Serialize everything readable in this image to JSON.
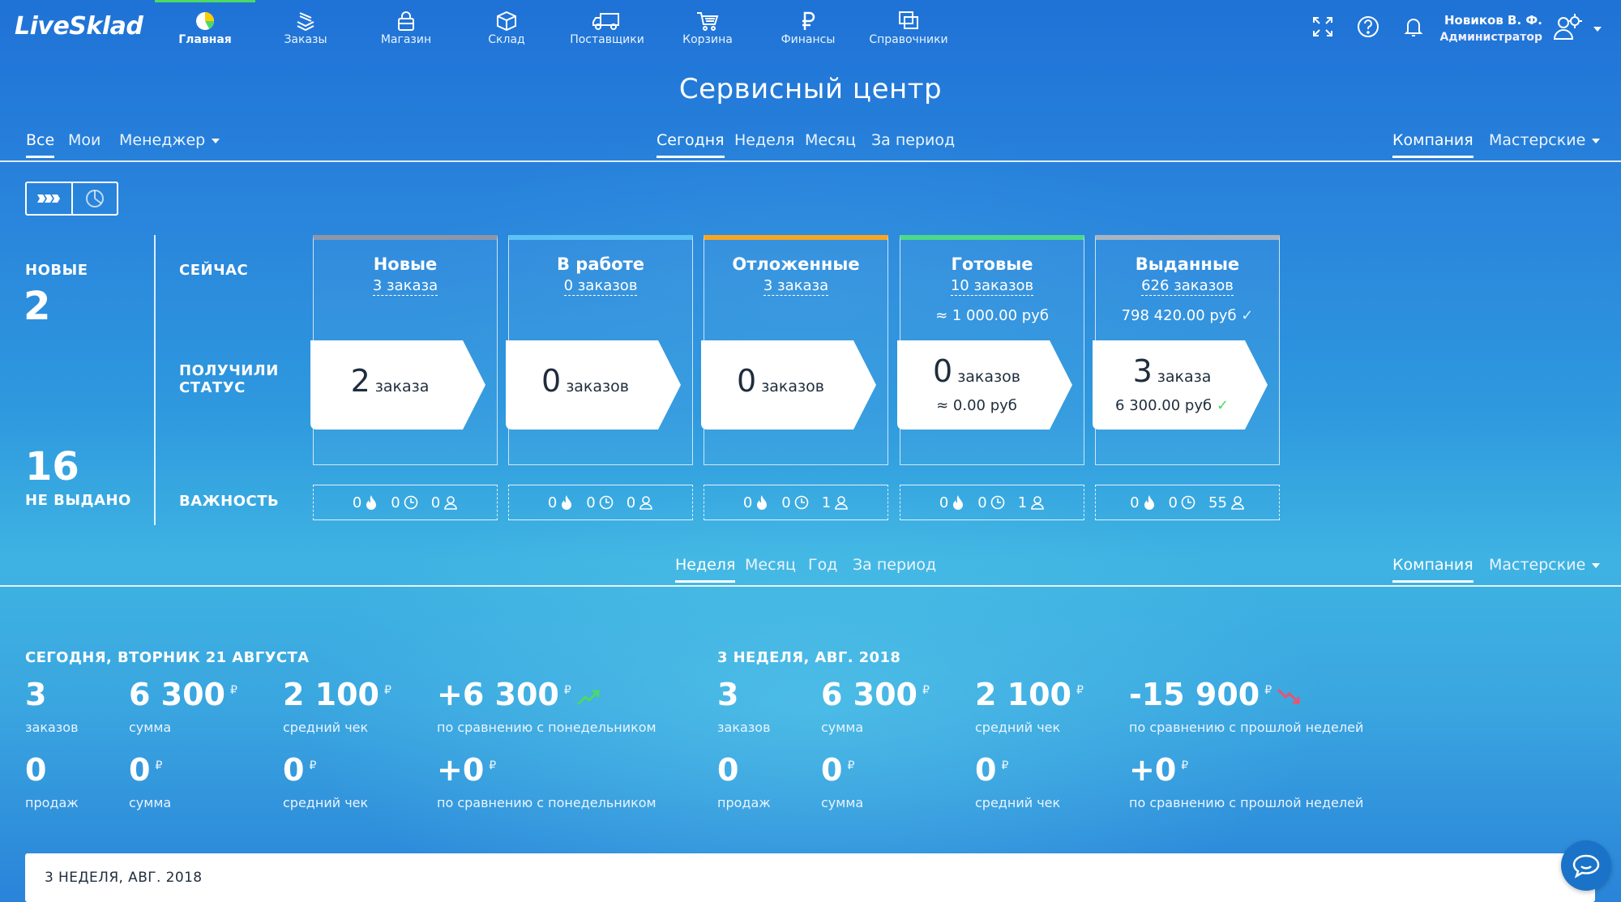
{
  "app": {
    "logo": "LiveSklad"
  },
  "nav": [
    {
      "label": "Главная",
      "icon": "pie-chart-icon",
      "active": true
    },
    {
      "label": "Заказы",
      "icon": "stack-icon"
    },
    {
      "label": "Магазин",
      "icon": "shopping-bag-icon"
    },
    {
      "label": "Склад",
      "icon": "box-icon"
    },
    {
      "label": "Поставщики",
      "icon": "truck-icon"
    },
    {
      "label": "Корзина",
      "icon": "cart-icon"
    },
    {
      "label": "Финансы",
      "icon": "ruble-icon"
    },
    {
      "label": "Справочники",
      "icon": "copy-icon"
    }
  ],
  "user": {
    "name": "Новиков В. Ф.",
    "role": "Администратор"
  },
  "page_title": "Сервисный центр",
  "filters_top": {
    "owner": [
      "Все",
      "Мои",
      "Менеджер"
    ],
    "period": [
      "Сегодня",
      "Неделя",
      "Месяц",
      "За период"
    ],
    "scope": [
      "Компания",
      "Мастерские"
    ]
  },
  "summary": {
    "new_label": "НОВЫЕ",
    "new_value": "2",
    "not_issued_value": "16",
    "not_issued_label": "НЕ ВЫДАНО",
    "now_label": "СЕЙЧАС",
    "got_status_label_1": "ПОЛУЧИЛИ",
    "got_status_label_2": "СТАТУС",
    "importance_label": "ВАЖНОСТЬ"
  },
  "statuses": [
    {
      "title": "Новые",
      "count": "3 заказа",
      "sum": "",
      "got_num": "2",
      "got_word": "заказа",
      "got_sum": "",
      "got_check": false,
      "color": "#8a97ab",
      "imp": [
        "0",
        "0",
        "0"
      ]
    },
    {
      "title": "В работе",
      "count": "0 заказов",
      "sum": "",
      "got_num": "0",
      "got_word": "заказов",
      "got_sum": "",
      "got_check": false,
      "color": "#5bc3f5",
      "imp": [
        "0",
        "0",
        "0"
      ]
    },
    {
      "title": "Отложенные",
      "count": "3 заказа",
      "sum": "",
      "got_num": "0",
      "got_word": "заказов",
      "got_sum": "",
      "got_check": false,
      "color": "#f5a623",
      "imp": [
        "0",
        "0",
        "1"
      ]
    },
    {
      "title": "Готовые",
      "count": "10 заказов",
      "sum": "≈ 1 000.00 руб",
      "got_num": "0",
      "got_word": "заказов",
      "got_sum": "≈ 0.00 руб",
      "got_check": false,
      "color": "#4cd98a",
      "imp": [
        "0",
        "0",
        "1"
      ]
    },
    {
      "title": "Выданные",
      "count": "626 заказов",
      "sum": "798 420.00 руб",
      "sum_check": "✓",
      "got_num": "3",
      "got_word": "заказа",
      "got_sum": "6 300.00 руб",
      "got_check": true,
      "color": "#a9b4c2",
      "imp": [
        "0",
        "0",
        "55"
      ]
    }
  ],
  "filters_mid": {
    "period": [
      "Неделя",
      "Месяц",
      "Год",
      "За период"
    ],
    "scope": [
      "Компания",
      "Мастерские"
    ]
  },
  "stats_today": {
    "header": "СЕГОДНЯ, ВТОРНИК 21 АВГУСТА",
    "row1": [
      {
        "value": "3",
        "cur": "",
        "label": "заказов"
      },
      {
        "value": "6 300",
        "cur": "₽",
        "label": "сумма"
      },
      {
        "value": "2 100",
        "cur": "₽",
        "label": "средний чек"
      },
      {
        "value": "+6 300",
        "cur": "₽",
        "label": "по сравнению с понедельником",
        "trend": "up"
      }
    ],
    "row2": [
      {
        "value": "0",
        "cur": "",
        "label": "продаж"
      },
      {
        "value": "0",
        "cur": "₽",
        "label": "сумма"
      },
      {
        "value": "0",
        "cur": "₽",
        "label": "средний чек"
      },
      {
        "value": "+0",
        "cur": "₽",
        "label": "по сравнению с понедельником"
      }
    ]
  },
  "stats_week": {
    "header": "3 НЕДЕЛЯ, АВГ. 2018",
    "row1": [
      {
        "value": "3",
        "cur": "",
        "label": "заказов"
      },
      {
        "value": "6 300",
        "cur": "₽",
        "label": "сумма"
      },
      {
        "value": "2 100",
        "cur": "₽",
        "label": "средний чек"
      },
      {
        "value": "-15 900",
        "cur": "₽",
        "label": "по сравнению с прошлой неделей",
        "trend": "down"
      }
    ],
    "row2": [
      {
        "value": "0",
        "cur": "",
        "label": "продаж"
      },
      {
        "value": "0",
        "cur": "₽",
        "label": "сумма"
      },
      {
        "value": "0",
        "cur": "₽",
        "label": "средний чек"
      },
      {
        "value": "+0",
        "cur": "₽",
        "label": "по сравнению с прошлой неделей"
      }
    ]
  },
  "chart_card": {
    "title": "3 НЕДЕЛЯ, АВГ. 2018"
  },
  "colors": {
    "active_nav": "#4cd964",
    "trend_up": "#4cd964",
    "trend_down": "#f0506e",
    "card_text": "#1f2d3d"
  }
}
